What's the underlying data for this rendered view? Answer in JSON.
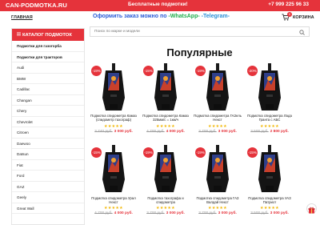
{
  "topbar": {
    "brand": "CAN-PODMOTKA.RU",
    "promo": "Бесплатные подмотки!",
    "phone": "+7 999 225 96 33"
  },
  "nav": {
    "home": "ГЛАВНАЯ",
    "order_prefix": "Оформить заказ можно по ",
    "order_wa": "-WhatsApp-",
    "order_tg": "-Telegram-",
    "cart_count": "0",
    "cart_label": "КОРЗИНА"
  },
  "sidebar": {
    "title": "КАТАЛОГ ПОДМОТОК",
    "items": [
      {
        "label": "Подмотки для газогорба",
        "bold": true
      },
      {
        "label": "Подмотки для тракторов",
        "bold": true
      },
      {
        "label": "Audi",
        "bold": false
      },
      {
        "label": "BMW",
        "bold": false
      },
      {
        "label": "Cadillac",
        "bold": false
      },
      {
        "label": "Changan",
        "bold": false
      },
      {
        "label": "Chery",
        "bold": false
      },
      {
        "label": "Chevrolet",
        "bold": false
      },
      {
        "label": "Citroen",
        "bold": false
      },
      {
        "label": "Daewoo",
        "bold": false
      },
      {
        "label": "Datsun",
        "bold": false
      },
      {
        "label": "Fiat",
        "bold": false
      },
      {
        "label": "Ford",
        "bold": false
      },
      {
        "label": "GAZ",
        "bold": false
      },
      {
        "label": "Geely",
        "bold": false
      },
      {
        "label": "Great Wall",
        "bold": false
      }
    ]
  },
  "search": {
    "placeholder": "Поиск по марке и модели"
  },
  "section": {
    "title": "Популярные"
  },
  "products": [
    {
      "badge": "-19%",
      "name": "Подмотка спидометра Камаз (спидометр тахограф)",
      "old": "3 740 руб.",
      "new": "3 000 руб.",
      "stars": "★★★★★"
    },
    {
      "badge": "-15%",
      "name": "Подмотка спидометра Камаз 325мм/с = 1км/ч",
      "old": "4 700 руб.",
      "new": "4 000 руб.",
      "stars": "★★★★★"
    },
    {
      "badge": "-19%",
      "name": "Подмотка спидометра ГАЗель Некст",
      "old": "3 700 руб.",
      "new": "3 000 руб.",
      "stars": "★★★★★"
    },
    {
      "badge": "-20%",
      "name": "Подмотка спидометра Лада Гранта с АБС",
      "old": "3 500 руб.",
      "new": "2 800 руб.",
      "stars": "★★★★★"
    },
    {
      "badge": "-15%",
      "name": "Подмотка спидометра Урал Некст",
      "old": "4 700 руб.",
      "new": "4 000 руб.",
      "stars": "★★★★★"
    },
    {
      "badge": "-19%",
      "name": "Подмотка тахографа и спидометра",
      "old": "3 700 руб.",
      "new": "3 000 руб.",
      "stars": "★★★★★"
    },
    {
      "badge": "-19%",
      "name": "Подмотка спидометра ГАЗ Валдай Некст",
      "old": "3 700 руб.",
      "new": "3 000 руб.",
      "stars": "★★★★★"
    },
    {
      "badge": "-15%",
      "name": "Подмотка спидометра УАЗ Патриот",
      "old": "3 500 руб.",
      "new": "3 000 руб.",
      "stars": "★★★★★"
    }
  ],
  "colors": {
    "accent": "#e5333b",
    "star": "#f2b705",
    "whatsapp": "#1fae4b",
    "link": "#2a5bd7"
  }
}
